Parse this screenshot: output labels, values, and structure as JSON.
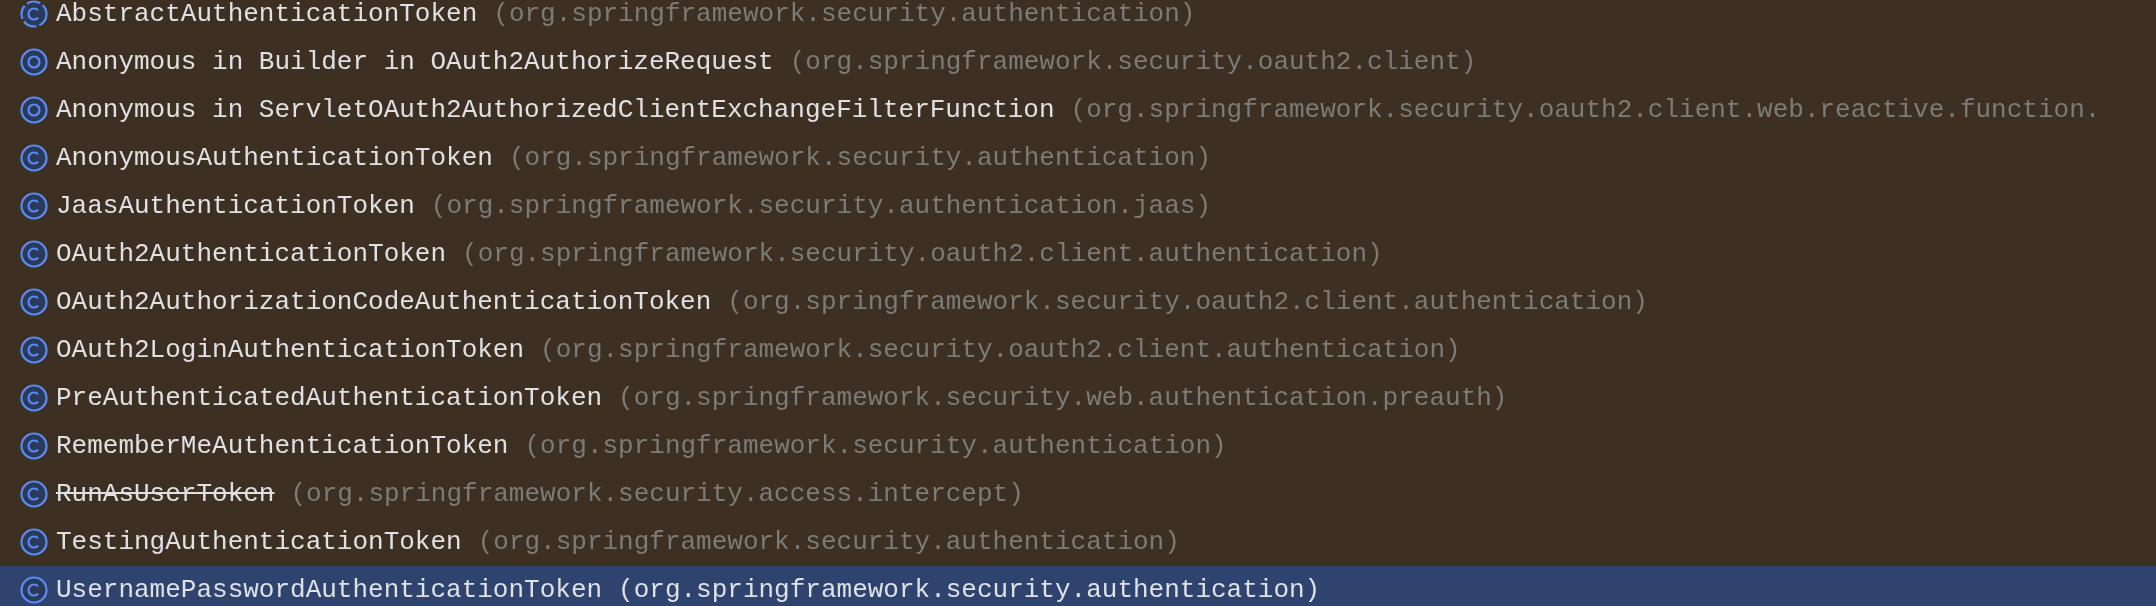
{
  "results": [
    {
      "kind": "abstract",
      "name": "AbstractAuthenticationToken",
      "package": "(org.springframework.security.authentication)",
      "deprecated": false,
      "selected": false
    },
    {
      "kind": "anonymous",
      "name": "Anonymous in Builder in OAuth2AuthorizeRequest",
      "package": "(org.springframework.security.oauth2.client)",
      "deprecated": false,
      "selected": false
    },
    {
      "kind": "anonymous",
      "name": "Anonymous in ServletOAuth2AuthorizedClientExchangeFilterFunction",
      "package": "(org.springframework.security.oauth2.client.web.reactive.function.",
      "deprecated": false,
      "selected": false
    },
    {
      "kind": "class",
      "name": "AnonymousAuthenticationToken",
      "package": "(org.springframework.security.authentication)",
      "deprecated": false,
      "selected": false
    },
    {
      "kind": "class",
      "name": "JaasAuthenticationToken",
      "package": "(org.springframework.security.authentication.jaas)",
      "deprecated": false,
      "selected": false
    },
    {
      "kind": "class",
      "name": "OAuth2AuthenticationToken",
      "package": "(org.springframework.security.oauth2.client.authentication)",
      "deprecated": false,
      "selected": false
    },
    {
      "kind": "class",
      "name": "OAuth2AuthorizationCodeAuthenticationToken",
      "package": "(org.springframework.security.oauth2.client.authentication)",
      "deprecated": false,
      "selected": false
    },
    {
      "kind": "class",
      "name": "OAuth2LoginAuthenticationToken",
      "package": "(org.springframework.security.oauth2.client.authentication)",
      "deprecated": false,
      "selected": false
    },
    {
      "kind": "class",
      "name": "PreAuthenticatedAuthenticationToken",
      "package": "(org.springframework.security.web.authentication.preauth)",
      "deprecated": false,
      "selected": false
    },
    {
      "kind": "class",
      "name": "RememberMeAuthenticationToken",
      "package": "(org.springframework.security.authentication)",
      "deprecated": false,
      "selected": false
    },
    {
      "kind": "class",
      "name": "RunAsUserToken",
      "package": "(org.springframework.security.access.intercept)",
      "deprecated": true,
      "selected": false
    },
    {
      "kind": "class",
      "name": "TestingAuthenticationToken",
      "package": "(org.springframework.security.authentication)",
      "deprecated": false,
      "selected": false
    },
    {
      "kind": "class",
      "name": "UsernamePasswordAuthenticationToken",
      "package": "(org.springframework.security.authentication)",
      "deprecated": false,
      "selected": true
    }
  ]
}
